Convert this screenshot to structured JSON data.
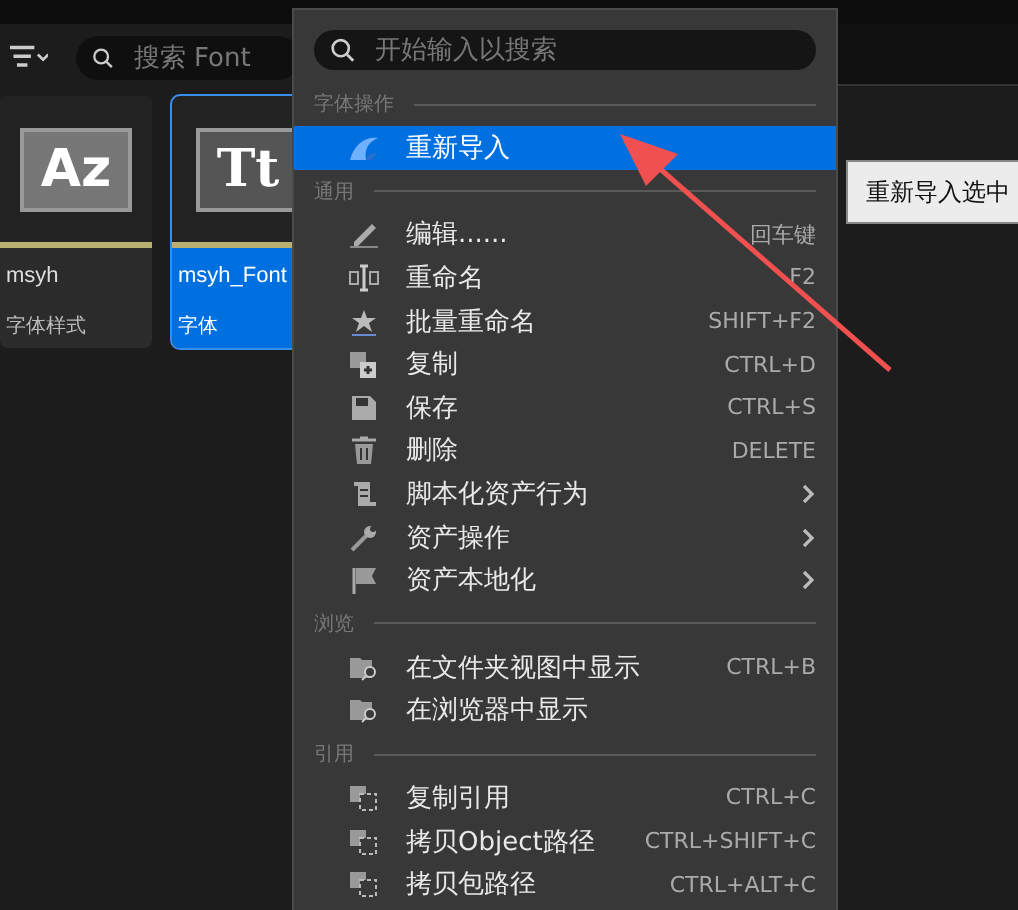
{
  "toolbar": {
    "search": {
      "placeholder": "搜索 Font"
    }
  },
  "assets": [
    {
      "thumb": "Az",
      "name": "msyh",
      "type": "字体样式",
      "selected": false
    },
    {
      "thumb": "Tt",
      "name": "msyh_Font",
      "type": "字体",
      "selected": true
    }
  ],
  "menu": {
    "search": {
      "placeholder": "开始输入以搜索"
    },
    "sections": [
      {
        "title": "字体操作",
        "items": [
          {
            "kind": "reimport",
            "label": "重新导入",
            "selected": true
          }
        ]
      },
      {
        "title": "通用",
        "items": [
          {
            "kind": "pencil",
            "label": "编辑......",
            "shortcut": "回车键",
            "selected": false
          },
          {
            "kind": "rename",
            "label": "重命名",
            "shortcut": "F2",
            "selected": false
          },
          {
            "kind": "star",
            "label": "批量重命名",
            "shortcut": "SHIFT+F2",
            "selected": false
          },
          {
            "kind": "duplicate",
            "label": "复制",
            "shortcut": "CTRL+D",
            "selected": false
          },
          {
            "kind": "save",
            "label": "保存",
            "shortcut": "CTRL+S",
            "selected": false
          },
          {
            "kind": "trash",
            "label": "删除",
            "shortcut": "DELETE",
            "selected": false
          },
          {
            "kind": "script",
            "label": "脚本化资产行为",
            "submenu": true,
            "selected": false
          },
          {
            "kind": "wrench",
            "label": "资产操作",
            "submenu": true,
            "selected": false
          },
          {
            "kind": "flag",
            "label": "资产本地化",
            "submenu": true,
            "selected": false
          }
        ]
      },
      {
        "title": "浏览",
        "items": [
          {
            "kind": "folder",
            "label": "在文件夹视图中显示",
            "shortcut": "CTRL+B",
            "selected": false
          },
          {
            "kind": "folder",
            "label": "在浏览器中显示",
            "selected": false
          }
        ]
      },
      {
        "title": "引用",
        "items": [
          {
            "kind": "ref",
            "label": "复制引用",
            "shortcut": "CTRL+C",
            "selected": false
          },
          {
            "kind": "ref",
            "label": "拷贝Object路径",
            "shortcut": "CTRL+SHIFT+C",
            "selected": false
          },
          {
            "kind": "ref",
            "label": "拷贝包路径",
            "shortcut": "CTRL+ALT+C",
            "selected": false
          }
        ]
      }
    ]
  },
  "tooltip": "重新导入选中"
}
